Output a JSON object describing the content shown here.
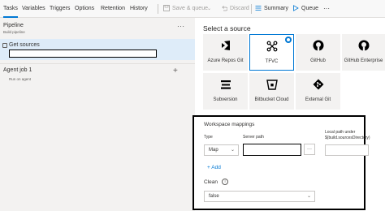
{
  "toolbar": {
    "tabs": [
      "Tasks",
      "Variables",
      "Triggers",
      "Options",
      "Retention",
      "History"
    ],
    "save_queue": "Save & queue",
    "discard": "Discard",
    "summary": "Summary",
    "queue": "Queue",
    "more": "···"
  },
  "pipeline": {
    "title": "Pipeline",
    "subtitle": "Build pipeline",
    "more": "···"
  },
  "get_sources": {
    "label": "Get sources"
  },
  "agent_job": {
    "label": "Agent job 1",
    "subtitle": "Run on agent",
    "add": "+"
  },
  "source_select": {
    "title": "Select a source",
    "tiles": [
      {
        "label": "Azure Repos Git",
        "icon": "azure-repos-icon",
        "selected": false
      },
      {
        "label": "TFVC",
        "icon": "tfvc-icon",
        "selected": true
      },
      {
        "label": "GitHub",
        "icon": "github-icon",
        "selected": false
      },
      {
        "label": "GitHub Enterprise",
        "icon": "github-enterprise-icon",
        "selected": false
      },
      {
        "label": "Subversion",
        "icon": "subversion-icon",
        "selected": false
      },
      {
        "label": "Bitbucket Cloud",
        "icon": "bitbucket-icon",
        "selected": false
      },
      {
        "label": "External Git",
        "icon": "git-icon",
        "selected": false
      }
    ]
  },
  "workspace": {
    "title": "Workspace mappings",
    "type_label": "Type",
    "type_value": "Map",
    "server_label": "Server path",
    "local_label_1": "Local path under",
    "local_label_2": "$(build.sourcesDirectory)",
    "browse": "···",
    "add": "+ Add",
    "clean_label": "Clean",
    "clean_value": "false"
  },
  "colors": {
    "accent": "#0078d4",
    "panel": "#f3f2f1",
    "selected_row": "#deecf9"
  }
}
